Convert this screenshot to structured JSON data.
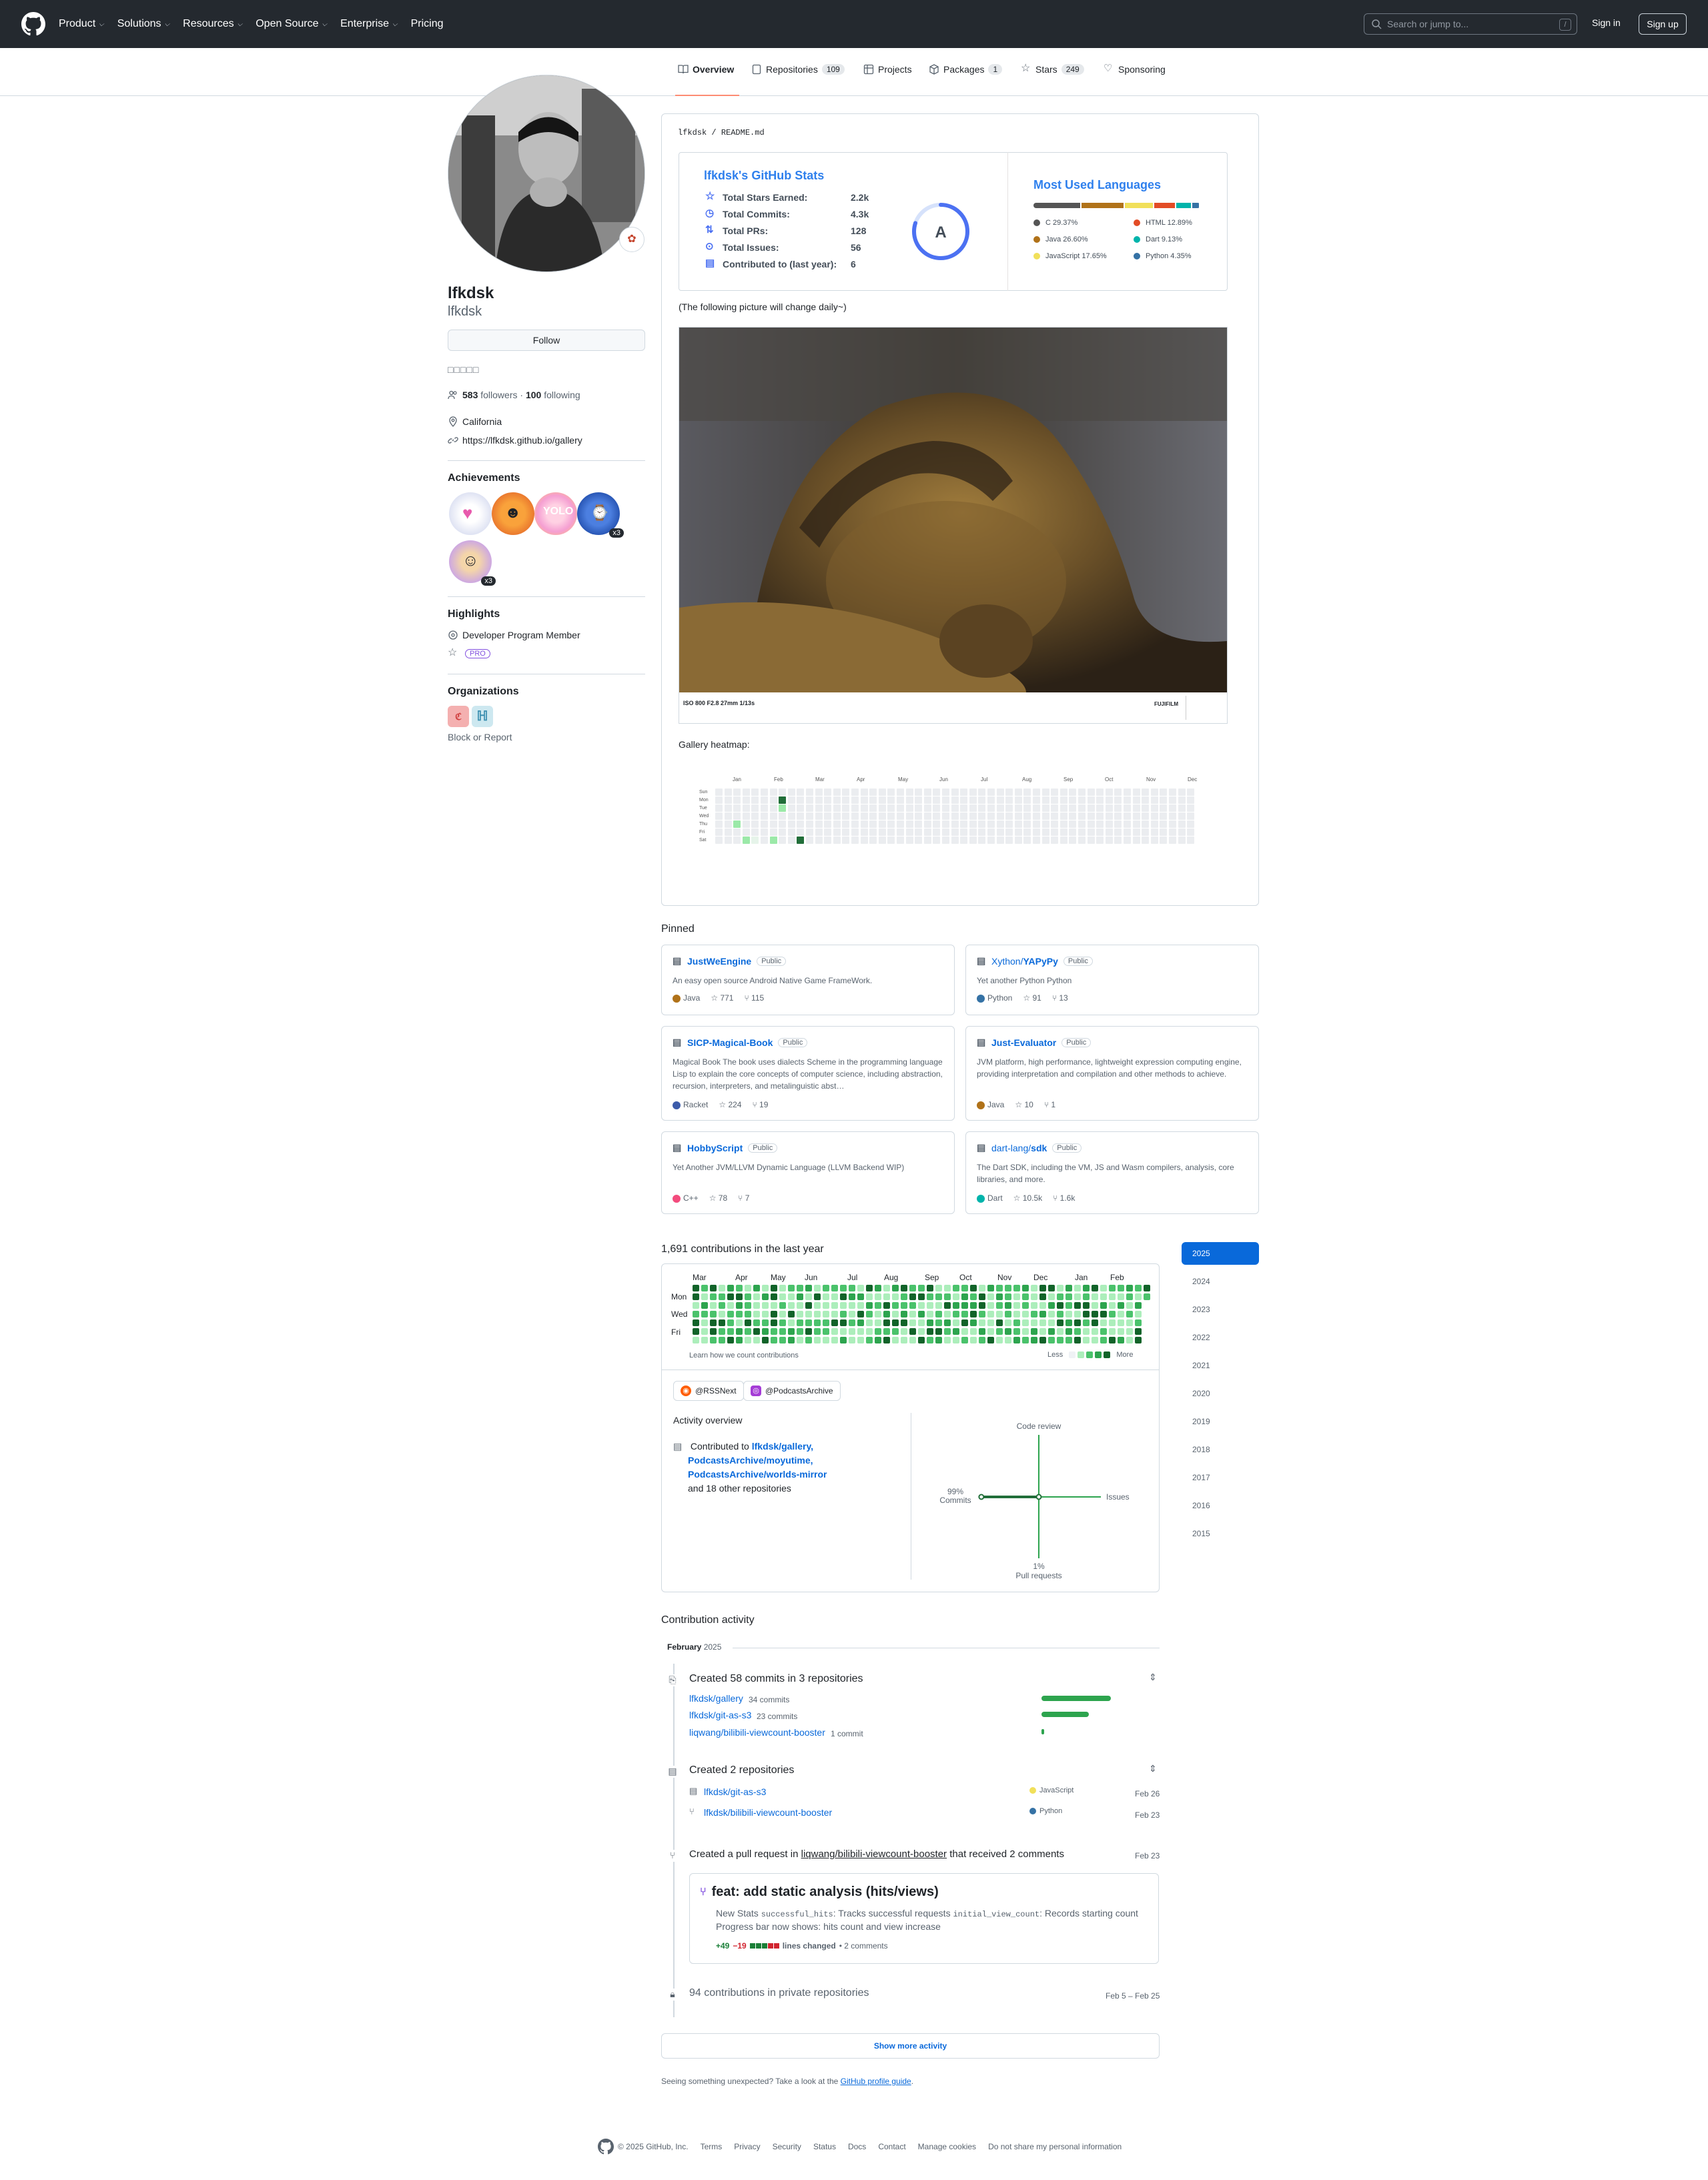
{
  "header": {
    "nav": [
      "Product",
      "Solutions",
      "Resources",
      "Open Source",
      "Enterprise",
      "Pricing"
    ],
    "search_placeholder": "Search or jump to...",
    "search_kbd": "/",
    "sign_in": "Sign in",
    "sign_up": "Sign up"
  },
  "tabs": [
    {
      "label": "Overview",
      "count": ""
    },
    {
      "label": "Repositories",
      "count": "109"
    },
    {
      "label": "Projects",
      "count": ""
    },
    {
      "label": "Packages",
      "count": "1"
    },
    {
      "label": "Stars",
      "count": "249"
    },
    {
      "label": "Sponsoring",
      "count": ""
    }
  ],
  "profile": {
    "name": "lfkdsk",
    "login": "lfkdsk",
    "follow_label": "Follow",
    "bio": "□□□□□",
    "followers_count": "583",
    "followers_label": "followers",
    "separator": "·",
    "following_count": "100",
    "following_label": "following",
    "location": "California",
    "website": "https://lfkdsk.github.io/gallery",
    "achievements_title": "Achievements",
    "achievement_badge_x3": "x3",
    "highlights_title": "Highlights",
    "highlight_1": "Developer Program Member",
    "highlight_pro": "PRO",
    "organizations_title": "Organizations",
    "block_report": "Block or Report"
  },
  "readme": {
    "path_user": "lfkdsk",
    "path_sep": "/",
    "path_file": "README.md",
    "stats_title": "lfkdsk's GitHub Stats",
    "stats": [
      {
        "label": "Total Stars Earned:",
        "value": "2.2k"
      },
      {
        "label": "Total Commits:",
        "value": "4.3k"
      },
      {
        "label": "Total PRs:",
        "value": "128"
      },
      {
        "label": "Total Issues:",
        "value": "56"
      },
      {
        "label": "Contributed to (last year):",
        "value": "6"
      }
    ],
    "rank": "A",
    "rank_progress": 0.8,
    "langs_title": "Most Used Languages",
    "langs": [
      {
        "name": "C 29.37%",
        "color": "#555555",
        "pct": 29.37
      },
      {
        "name": "Java 26.60%",
        "color": "#b07219",
        "pct": 26.6
      },
      {
        "name": "JavaScript 17.65%",
        "color": "#f1e05a",
        "pct": 17.65
      },
      {
        "name": "HTML 12.89%",
        "color": "#e34c26",
        "pct": 12.89
      },
      {
        "name": "Dart 9.13%",
        "color": "#00b4ab",
        "pct": 9.13
      },
      {
        "name": "Python 4.35%",
        "color": "#3572a5",
        "pct": 4.35
      }
    ],
    "daily_note": "(The following picture will change daily~)",
    "photo_caption": "ISO 800 F2.8 27mm 1/13s",
    "photo_brand": "FUJIFILM",
    "heatmap_label": "Gallery heatmap:",
    "heatmap_months": [
      "Jan",
      "Feb",
      "Mar",
      "Apr",
      "May",
      "Jun",
      "Jul",
      "Aug",
      "Sep",
      "Oct",
      "Nov",
      "Dec"
    ],
    "heatmap_days": [
      "Sun",
      "Mon",
      "Tue",
      "Wed",
      "Thu",
      "Fri",
      "Sat"
    ]
  },
  "pinned": {
    "title": "Pinned",
    "public": "Public",
    "repos": [
      {
        "owner": "",
        "name": "JustWeEngine",
        "desc": "An easy open source Android Native Game FrameWork.",
        "lang": "Java",
        "color": "#b07219",
        "stars": "771",
        "forks": "115"
      },
      {
        "owner": "Xython/",
        "name": "YAPyPy",
        "desc": "Yet another Python Python",
        "lang": "Python",
        "color": "#3572a5",
        "stars": "91",
        "forks": "13"
      },
      {
        "owner": "",
        "name": "SICP-Magical-Book",
        "desc": "Magical Book The book uses dialects Scheme in the programming language Lisp to explain the core concepts of computer science, including abstraction, recursion, interpreters, and metalinguistic abst…",
        "lang": "Racket",
        "color": "#3c5caa",
        "stars": "224",
        "forks": "19"
      },
      {
        "owner": "",
        "name": "Just-Evaluator",
        "desc": "JVM platform, high performance, lightweight expression computing engine, providing interpretation and compilation and other methods to achieve.",
        "lang": "Java",
        "color": "#b07219",
        "stars": "10",
        "forks": "1"
      },
      {
        "owner": "",
        "name": "HobbyScript",
        "desc": "Yet Another JVM/LLVM Dynamic Language (LLVM Backend WIP)",
        "lang": "C++",
        "color": "#f34b7d",
        "stars": "78",
        "forks": "7"
      },
      {
        "owner": "dart-lang/",
        "name": "sdk",
        "desc": "The Dart SDK, including the VM, JS and Wasm compilers, analysis, core libraries, and more.",
        "lang": "Dart",
        "color": "#00b4ab",
        "stars": "10.5k",
        "forks": "1.6k"
      }
    ]
  },
  "contributions": {
    "title": "1,691 contributions in the last year",
    "months": [
      "Mar",
      "Apr",
      "May",
      "Jun",
      "Jul",
      "Aug",
      "Sep",
      "Oct",
      "Nov",
      "Dec",
      "Jan",
      "Feb"
    ],
    "days": [
      "Mon",
      "Wed",
      "Fri"
    ],
    "learn_how": "Learn how we count contributions",
    "less": "Less",
    "more": "More",
    "org_chips": [
      "@RSSNext",
      "@PodcastsArchive"
    ],
    "activity_overview": "Activity overview",
    "contributed_to": "Contributed to",
    "repo_1": "lfkdsk/gallery,",
    "repo_2": "PodcastsArchive/moyutime,",
    "repo_3": "PodcastsArchive/worlds-mirror",
    "and_more": "and 18 other repositories",
    "axis_code_review": "Code review",
    "axis_issues": "Issues",
    "axis_commits_pct": "99%",
    "axis_commits": "Commits",
    "axis_pr_pct": "1%",
    "axis_pr": "Pull requests",
    "commits_share": 0.99,
    "pull_requests_share": 0.01,
    "years": [
      "2025",
      "2024",
      "2023",
      "2022",
      "2021",
      "2020",
      "2019",
      "2018",
      "2017",
      "2016",
      "2015"
    ]
  },
  "activity": {
    "title": "Contribution activity",
    "month": "February",
    "year": "2025",
    "commits_title": "Created 58 commits in 3 repositories",
    "commit_repos": [
      {
        "name": "lfkdsk/gallery",
        "count": "34 commits",
        "share": 1.0
      },
      {
        "name": "lfkdsk/git-as-s3",
        "count": "23 commits",
        "share": 0.68
      },
      {
        "name": "liqwang/bilibili-viewcount-booster",
        "count": "1 commit",
        "share": 0.03
      }
    ],
    "repos_title": "Created 2 repositories",
    "created_repos": [
      {
        "name": "lfkdsk/git-as-s3",
        "lang": "JavaScript",
        "color": "#f1e05a",
        "date": "Feb 26"
      },
      {
        "name": "lfkdsk/bilibili-viewcount-booster",
        "lang": "Python",
        "color": "#3572a5",
        "date": "Feb 23"
      }
    ],
    "pr_prefix": "Created a pull request in",
    "pr_repo": "liqwang/bilibili-viewcount-booster",
    "pr_suffix": "that received 2 comments",
    "pr_date": "Feb 23",
    "pr_title": "feat: add static analysis (hits/views)",
    "pr_body_1a": "New Stats",
    "pr_code_1": "successful_hits",
    "pr_body_1b": ": Tracks successful requests",
    "pr_code_2": "initial_view_count",
    "pr_body_1c": ": Records starting count",
    "pr_body_2": "Progress bar now shows: hits count and view increase",
    "pr_add": "+49",
    "pr_del": "−19",
    "pr_lines": "lines changed",
    "pr_comments": "• 2 comments",
    "private_text": "94 contributions in private repositories",
    "private_date": "Feb 5 – Feb 25",
    "show_more": "Show more activity",
    "unexpected": "Seeing something unexpected? Take a look at the",
    "guide": "GitHub profile guide",
    "period": "."
  },
  "footer": {
    "copyright": "© 2025 GitHub, Inc.",
    "links": [
      "Terms",
      "Privacy",
      "Security",
      "Status",
      "Docs",
      "Contact",
      "Manage cookies",
      "Do not share my personal information"
    ]
  }
}
